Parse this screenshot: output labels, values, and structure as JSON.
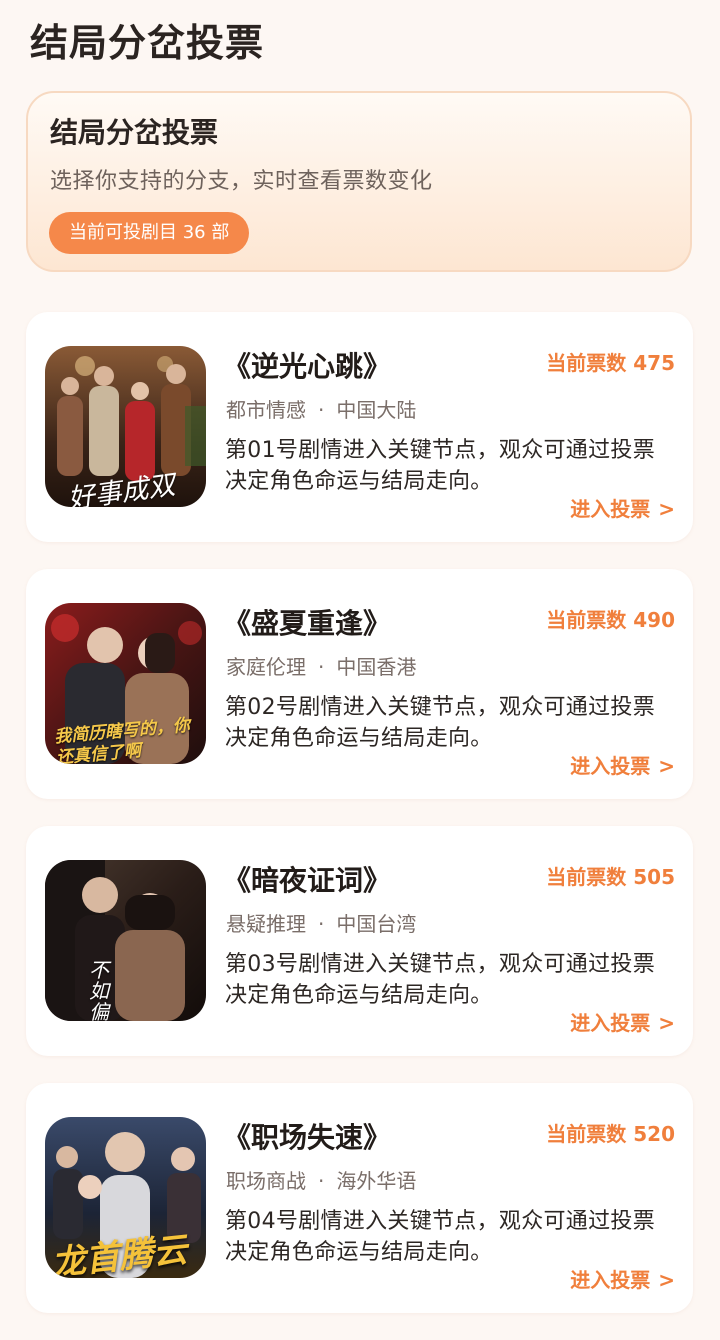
{
  "page": {
    "title": "结局分岔投票"
  },
  "hero": {
    "title": "结局分岔投票",
    "subtitle": "选择你支持的分支，实时查看票数变化",
    "badge": "当前可投剧目 36 部"
  },
  "dramas": [
    {
      "title": "《逆光心跳》",
      "votes_label": "当前票数 475",
      "votes": 475,
      "genre": "都市情感",
      "region": "中国大陆",
      "separator": "·",
      "description": "第01号剧情进入关键节点，观众可通过投票决定角色命运与结局走向。",
      "cta": "进入投票",
      "cta_arrow": ">",
      "cover_text": "好事成双",
      "cover_colors": [
        "#6b3a22",
        "#2a1a14",
        "#b23a2a"
      ]
    },
    {
      "title": "《盛夏重逢》",
      "votes_label": "当前票数 490",
      "votes": 490,
      "genre": "家庭伦理",
      "region": "中国香港",
      "separator": "·",
      "description": "第02号剧情进入关键节点，观众可通过投票决定角色命运与结局走向。",
      "cta": "进入投票",
      "cta_arrow": ">",
      "cover_text": "我简历瞎写的，你还真信了啊",
      "cover_colors": [
        "#7a1e1e",
        "#2c1413",
        "#d8b38a"
      ]
    },
    {
      "title": "《暗夜证词》",
      "votes_label": "当前票数 505",
      "votes": 505,
      "genre": "悬疑推理",
      "region": "中国台湾",
      "separator": "·",
      "description": "第03号剧情进入关键节点，观众可通过投票决定角色命运与结局走向。",
      "cta": "进入投票",
      "cta_arrow": ">",
      "cover_text": "不如偏",
      "cover_colors": [
        "#3a2a22",
        "#1a1210",
        "#8a6a55"
      ]
    },
    {
      "title": "《职场失速》",
      "votes_label": "当前票数 520",
      "votes": 520,
      "genre": "职场商战",
      "region": "海外华语",
      "separator": "·",
      "description": "第04号剧情进入关键节点，观众可通过投票决定角色命运与结局走向。",
      "cta": "进入投票",
      "cta_arrow": ">",
      "cover_text": "龙首腾云",
      "cover_colors": [
        "#2b3a55",
        "#141a26",
        "#e0a233"
      ]
    }
  ],
  "colors": {
    "accent": "#f07f3c",
    "badge": "#f5884a",
    "background": "#fdf7f3"
  }
}
